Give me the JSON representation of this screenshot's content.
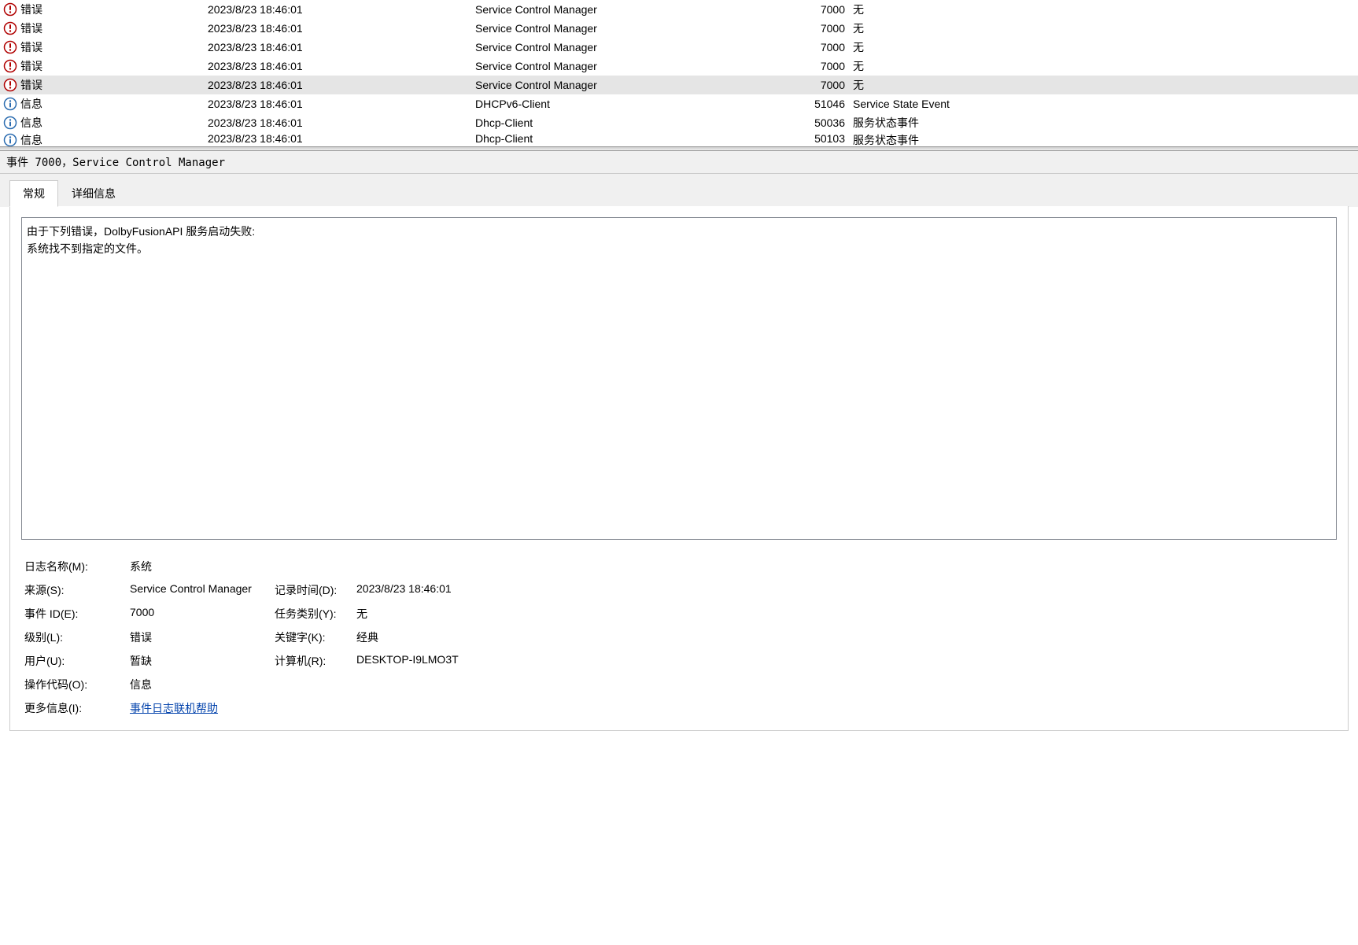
{
  "events": [
    {
      "type": "error",
      "level": "错误",
      "date": "2023/8/23 18:46:01",
      "source": "Service Control Manager",
      "id": "7000",
      "category": "无",
      "selected": false
    },
    {
      "type": "error",
      "level": "错误",
      "date": "2023/8/23 18:46:01",
      "source": "Service Control Manager",
      "id": "7000",
      "category": "无",
      "selected": false
    },
    {
      "type": "error",
      "level": "错误",
      "date": "2023/8/23 18:46:01",
      "source": "Service Control Manager",
      "id": "7000",
      "category": "无",
      "selected": false
    },
    {
      "type": "error",
      "level": "错误",
      "date": "2023/8/23 18:46:01",
      "source": "Service Control Manager",
      "id": "7000",
      "category": "无",
      "selected": false
    },
    {
      "type": "error",
      "level": "错误",
      "date": "2023/8/23 18:46:01",
      "source": "Service Control Manager",
      "id": "7000",
      "category": "无",
      "selected": true
    },
    {
      "type": "info",
      "level": "信息",
      "date": "2023/8/23 18:46:01",
      "source": "DHCPv6-Client",
      "id": "51046",
      "category": "Service State Event",
      "selected": false
    },
    {
      "type": "info",
      "level": "信息",
      "date": "2023/8/23 18:46:01",
      "source": "Dhcp-Client",
      "id": "50036",
      "category": "服务状态事件",
      "selected": false
    },
    {
      "type": "info",
      "level": "信息",
      "date": "2023/8/23 18:46:01",
      "source": "Dhcp-Client",
      "id": "50103",
      "category": "服务状态事件",
      "selected": false
    }
  ],
  "detail_header": "事件 7000，Service Control Manager",
  "tabs": {
    "general": "常规",
    "details": "详细信息"
  },
  "description": "由于下列错误，DolbyFusionAPI 服务启动失败: \n系统找不到指定的文件。",
  "properties": {
    "log_name_label": "日志名称(M):",
    "log_name_value": "系统",
    "source_label": "来源(S):",
    "source_value": "Service Control Manager",
    "logged_label": "记录时间(D):",
    "logged_value": "2023/8/23 18:46:01",
    "event_id_label": "事件 ID(E):",
    "event_id_value": "7000",
    "task_category_label": "任务类别(Y):",
    "task_category_value": "无",
    "level_label": "级别(L):",
    "level_value": "错误",
    "keywords_label": "关键字(K):",
    "keywords_value": "经典",
    "user_label": "用户(U):",
    "user_value": "暂缺",
    "computer_label": "计算机(R):",
    "computer_value": "DESKTOP-I9LMO3T",
    "opcode_label": "操作代码(O):",
    "opcode_value": "信息",
    "more_info_label": "更多信息(I):",
    "more_info_link": "事件日志联机帮助"
  }
}
